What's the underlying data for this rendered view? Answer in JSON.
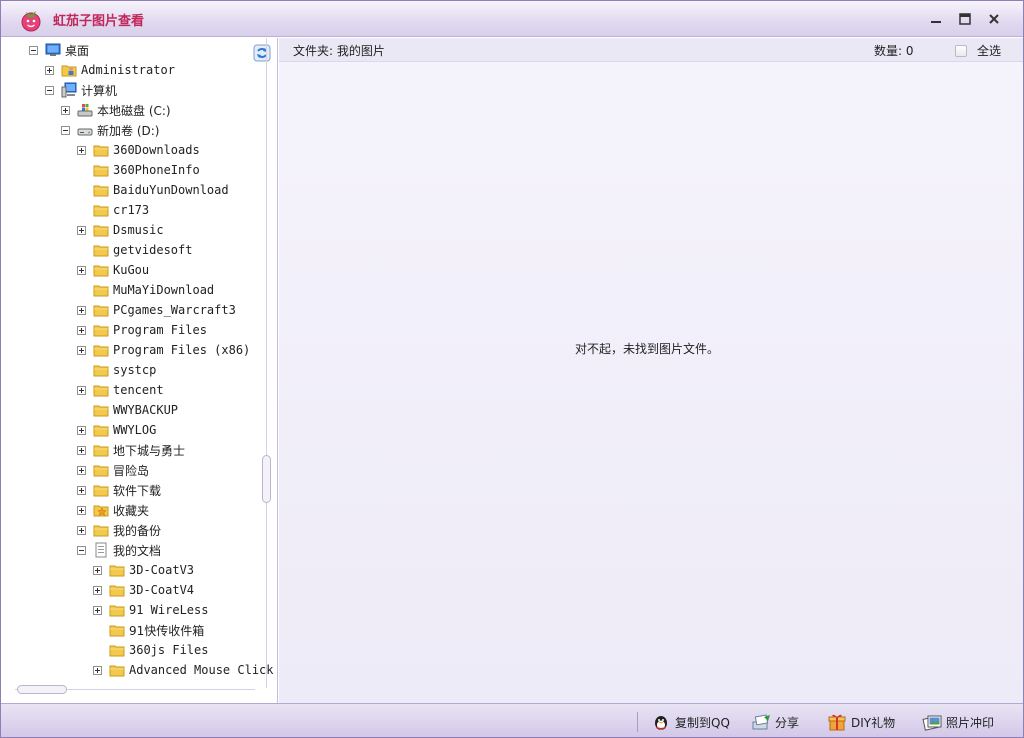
{
  "window": {
    "title": "虹茄子图片查看",
    "controls": {
      "minimize": "minimize",
      "maximize": "maximize",
      "close": "close"
    }
  },
  "tree": {
    "nodes": [
      {
        "label": "桌面",
        "expander": "minus",
        "icon": "desktop-icon",
        "level": 0
      },
      {
        "label": "Administrator",
        "expander": "plus",
        "icon": "user-folder-icon",
        "level": 1
      },
      {
        "label": "计算机",
        "expander": "minus",
        "icon": "computer-icon",
        "level": 1
      },
      {
        "label": "本地磁盘 (C:)",
        "expander": "plus",
        "icon": "system-drive-icon",
        "level": 2
      },
      {
        "label": "新加卷 (D:)",
        "expander": "minus",
        "icon": "drive-icon",
        "level": 2
      },
      {
        "label": "360Downloads",
        "expander": "plus",
        "icon": "folder-icon",
        "level": 3
      },
      {
        "label": "360PhoneInfo",
        "expander": "none",
        "icon": "folder-icon",
        "level": 3
      },
      {
        "label": "BaiduYunDownload",
        "expander": "none",
        "icon": "folder-icon",
        "level": 3
      },
      {
        "label": "cr173",
        "expander": "none",
        "icon": "folder-icon",
        "level": 3
      },
      {
        "label": "Dsmusic",
        "expander": "plus",
        "icon": "folder-icon",
        "level": 3
      },
      {
        "label": "getvidesoft",
        "expander": "none",
        "icon": "folder-icon",
        "level": 3
      },
      {
        "label": "KuGou",
        "expander": "plus",
        "icon": "folder-icon",
        "level": 3
      },
      {
        "label": "MuMaYiDownload",
        "expander": "none",
        "icon": "folder-icon",
        "level": 3
      },
      {
        "label": "PCgames_Warcraft3",
        "expander": "plus",
        "icon": "folder-icon",
        "level": 3
      },
      {
        "label": "Program Files",
        "expander": "plus",
        "icon": "folder-icon",
        "level": 3
      },
      {
        "label": "Program Files (x86)",
        "expander": "plus",
        "icon": "folder-icon",
        "level": 3
      },
      {
        "label": "systcp",
        "expander": "none",
        "icon": "folder-icon",
        "level": 3
      },
      {
        "label": "tencent",
        "expander": "plus",
        "icon": "folder-icon",
        "level": 3
      },
      {
        "label": "WWYBACKUP",
        "expander": "none",
        "icon": "folder-icon",
        "level": 3
      },
      {
        "label": "WWYLOG",
        "expander": "plus",
        "icon": "folder-icon",
        "level": 3
      },
      {
        "label": "地下城与勇士",
        "expander": "plus",
        "icon": "folder-icon",
        "level": 3
      },
      {
        "label": "冒险岛",
        "expander": "plus",
        "icon": "folder-icon",
        "level": 3
      },
      {
        "label": "软件下载",
        "expander": "plus",
        "icon": "folder-icon",
        "level": 3
      },
      {
        "label": "收藏夹",
        "expander": "plus",
        "icon": "favorites-folder-icon",
        "level": 3
      },
      {
        "label": "我的备份",
        "expander": "plus",
        "icon": "folder-icon",
        "level": 3
      },
      {
        "label": "我的文档",
        "expander": "minus",
        "icon": "documents-folder-icon",
        "level": 3
      },
      {
        "label": "3D-CoatV3",
        "expander": "plus",
        "icon": "folder-icon",
        "level": 4
      },
      {
        "label": "3D-CoatV4",
        "expander": "plus",
        "icon": "folder-icon",
        "level": 4
      },
      {
        "label": "91 WireLess",
        "expander": "plus",
        "icon": "folder-icon",
        "level": 4
      },
      {
        "label": "91快传收件箱",
        "expander": "none",
        "icon": "folder-icon",
        "level": 4
      },
      {
        "label": "360js Files",
        "expander": "none",
        "icon": "folder-icon",
        "level": 4
      },
      {
        "label": "Advanced Mouse Click",
        "expander": "plus",
        "icon": "folder-icon",
        "level": 4
      }
    ]
  },
  "content": {
    "folder_label": "文件夹: 我的图片",
    "count_label": "数量: 0",
    "select_all": "全选",
    "empty_message": "对不起，未找到图片文件。"
  },
  "bottombar": {
    "buttons": [
      {
        "label": "复制到QQ",
        "icon": "qq-penguin-icon"
      },
      {
        "label": "分享",
        "icon": "share-icon"
      },
      {
        "label": "DIY礼物",
        "icon": "gift-icon"
      },
      {
        "label": "照片冲印",
        "icon": "photo-print-icon"
      }
    ]
  },
  "colors": {
    "title_text": "#c0285b",
    "folder_yellow": "#f2c94c",
    "accent": "#b9a9d6"
  }
}
